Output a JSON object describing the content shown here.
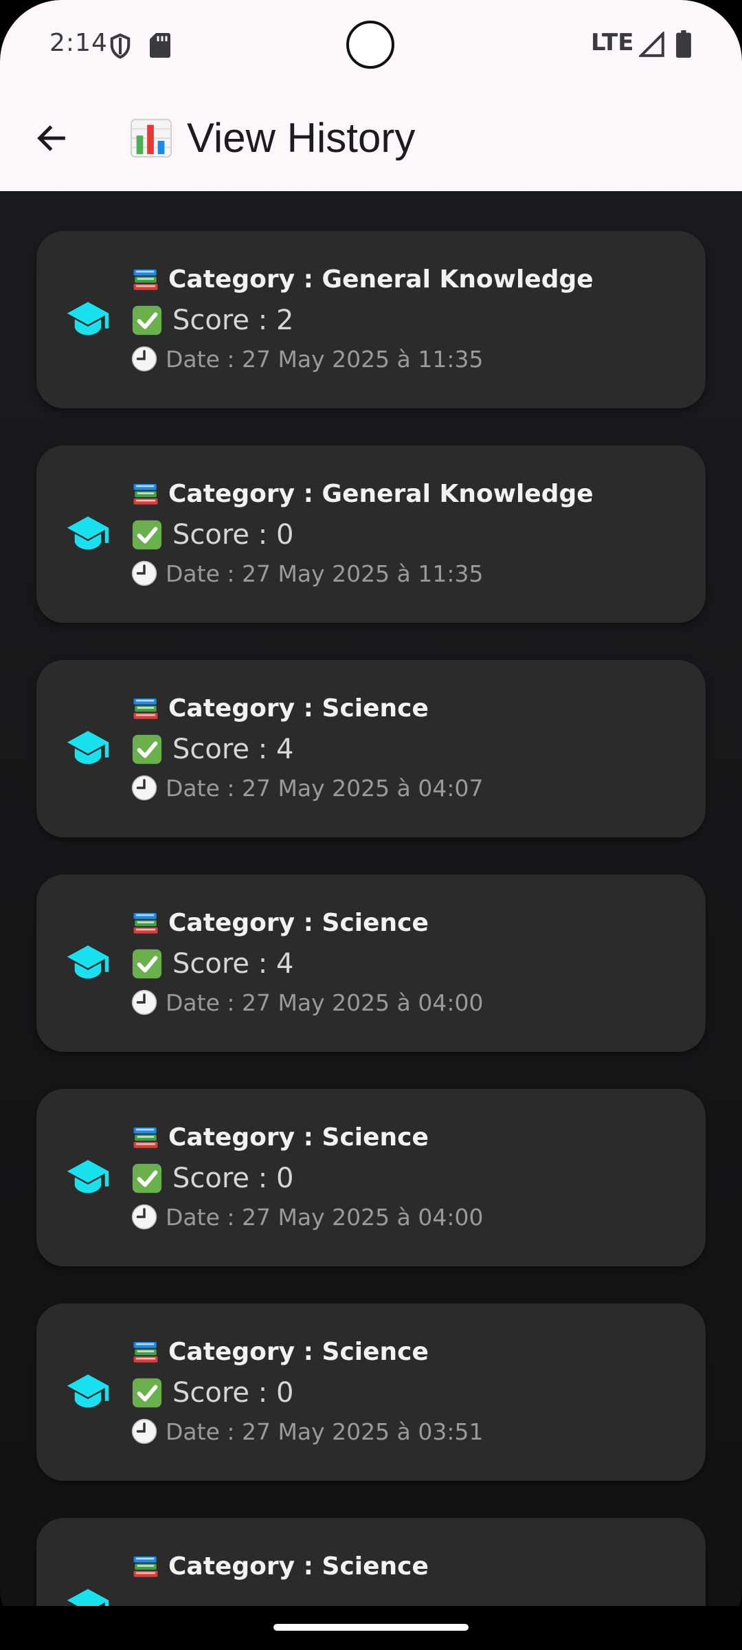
{
  "status_bar": {
    "time": "2:14",
    "network": "LTE"
  },
  "app_bar": {
    "back_icon": "arrow-back-icon",
    "title_icon": "bar-chart-emoji-icon",
    "title": "View History"
  },
  "colors": {
    "accent_icon": "#18e2f0",
    "card_bg": "#2b2b2c",
    "appbar_bg": "#fdf6fb"
  },
  "history": [
    {
      "category": "Category : General Knowledge",
      "score": "Score : 2",
      "date": "Date : 27 May 2025 à 11:35"
    },
    {
      "category": "Category : General Knowledge",
      "score": "Score : 0",
      "date": "Date : 27 May 2025 à 11:35"
    },
    {
      "category": "Category : Science",
      "score": "Score : 4",
      "date": "Date : 27 May 2025 à 04:07"
    },
    {
      "category": "Category : Science",
      "score": "Score : 4",
      "date": "Date : 27 May 2025 à 04:00"
    },
    {
      "category": "Category : Science",
      "score": "Score : 0",
      "date": "Date : 27 May 2025 à 04:00"
    },
    {
      "category": "Category : Science",
      "score": "Score : 0",
      "date": "Date : 27 May 2025 à 03:51"
    },
    {
      "category": "Category : Science"
    }
  ]
}
